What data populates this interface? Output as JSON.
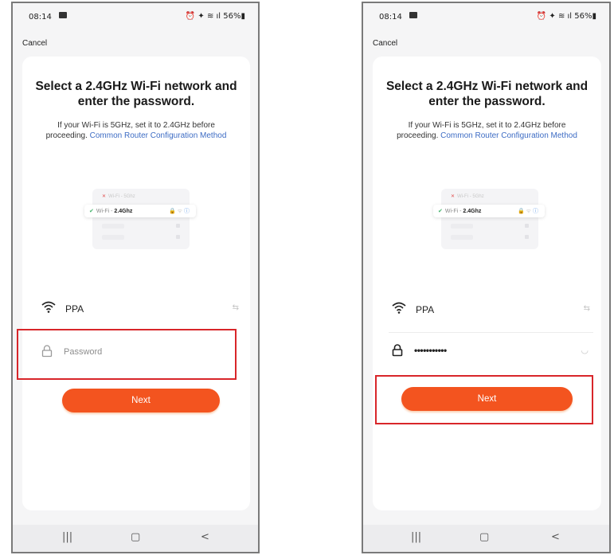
{
  "status_bar": {
    "time": "08:14",
    "icons_text": "⏰ ✦ ≋ ˙ıl 56%",
    "battery": "56%"
  },
  "cancel_label": "Cancel",
  "title": "Select a 2.4GHz Wi-Fi network and enter the password.",
  "subtitle_text": "If your Wi-Fi is 5GHz, set it to 2.4GHz before proceeding.",
  "subtitle_link": "Common Router Configuration Method",
  "illustration": {
    "wifi_5": "Wi-Fi - 5Ghz",
    "wifi_24_prefix": "Wi-Fi - ",
    "wifi_24_bold": "2.4Ghz"
  },
  "network": {
    "ssid": "PPA"
  },
  "password": {
    "placeholder": "Password",
    "masked_value": "•••••••••••"
  },
  "next_label": "Next",
  "nav": {
    "recents": "|||",
    "home": "▢",
    "back": "<"
  },
  "colors": {
    "accent": "#f3541f",
    "link": "#3d6cc4",
    "highlight": "#d8262a"
  }
}
